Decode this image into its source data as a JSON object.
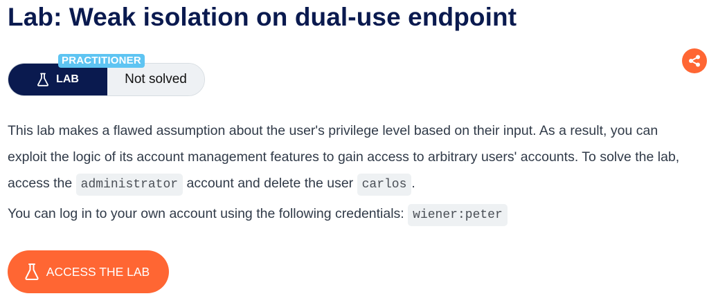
{
  "header": {
    "title": "Lab: Weak isolation on dual-use endpoint"
  },
  "share": {
    "icon": "share-icon"
  },
  "badge": {
    "level": "PRACTITIONER",
    "lab_label": "LAB",
    "status": "Not solved",
    "lab_icon": "flask-icon"
  },
  "description": {
    "part1": "This lab makes a flawed assumption about the user's privilege level based on their input. As a result, you can exploit the logic of its account management features to gain access to arbitrary users' accounts. To solve the lab, access the ",
    "code1": "administrator",
    "part2": " account and delete the user ",
    "code2": "carlos",
    "part3": "."
  },
  "credentials": {
    "text": "You can log in to your own account using the following credentials: ",
    "code": "wiener:peter"
  },
  "access_button": {
    "label": "ACCESS THE LAB",
    "icon": "flask-icon"
  },
  "colors": {
    "title": "#0a1a4f",
    "accent": "#ff6633",
    "level_tag": "#5ec4f2",
    "lab_pill": "#0a1a4f",
    "status_pill": "#eef1f4"
  }
}
